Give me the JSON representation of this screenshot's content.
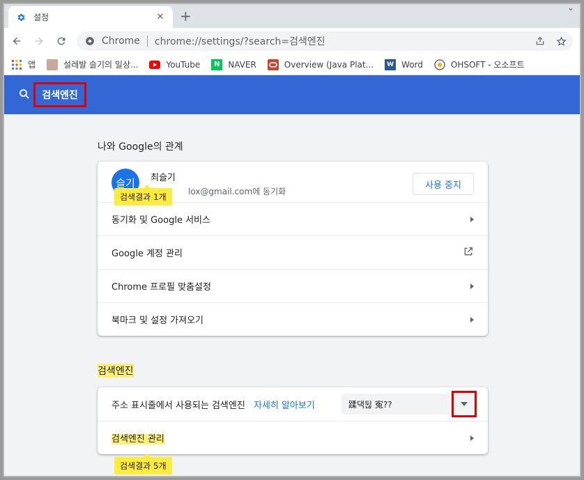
{
  "tab": {
    "title": "설정",
    "close": "✕",
    "new_tab": "+"
  },
  "omnibox": {
    "site": "Chrome",
    "url": "chrome://settings/?search=검색엔진"
  },
  "bookmarks": [
    {
      "label": "앱",
      "icon": "apps-grid-icon"
    },
    {
      "label": "설레발 슬기의 일상...",
      "icon": "profile-thumb-icon"
    },
    {
      "label": "YouTube",
      "icon": "youtube-icon"
    },
    {
      "label": "NAVER",
      "icon": "naver-icon"
    },
    {
      "label": "Overview (Java Plat...",
      "icon": "oracle-icon"
    },
    {
      "label": "Word",
      "icon": "word-icon"
    },
    {
      "label": "OHSOFT - 오소프트",
      "icon": "ohsoft-icon"
    }
  ],
  "header": {
    "search_value": "검색엔진"
  },
  "you_google": {
    "title": "나와 Google의 관계",
    "avatar_text": "슬기",
    "name": "최슬기",
    "email_tail": "lox@gmail.com에 동기화",
    "stop_label": "사용 중지",
    "bubble": "검색결과 1개",
    "rows": [
      {
        "label": "동기화 및 Google 서비스",
        "action": "arrow"
      },
      {
        "label": "Google 계정 관리",
        "action": "external"
      },
      {
        "label": "Chrome 프로필 맞춤설정",
        "action": "arrow"
      },
      {
        "label": "북마크 및 설정 가져오기",
        "action": "arrow"
      }
    ]
  },
  "search_engine": {
    "title": "검색엔진",
    "row1_label": "주소 표시줄에서 사용되는 검색엔진",
    "row1_link": "자세히 알아보기",
    "select_value": "蹂댁뒪 寃??",
    "row2_label": "검색엔진 관리",
    "bubble": "검색결과 5개"
  },
  "colors": {
    "header_blue": "#3367d6",
    "highlight": "#fff176",
    "red_box": "#e00000",
    "link": "#1a73e8"
  }
}
